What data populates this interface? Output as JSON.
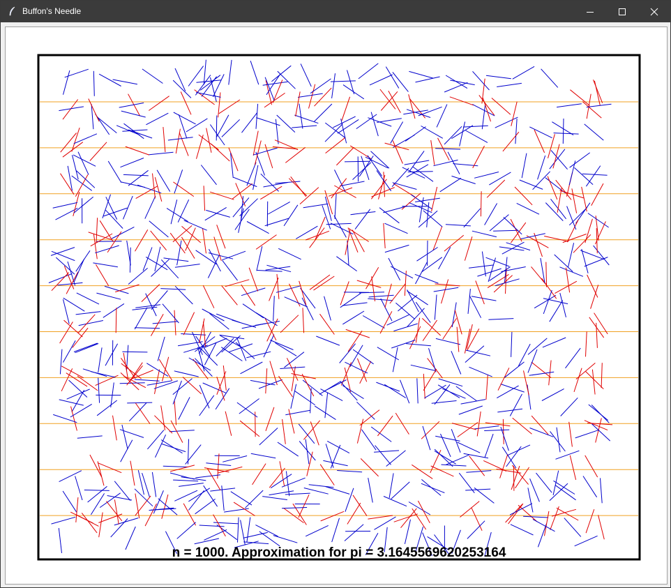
{
  "window": {
    "title": "Buffon's Needle",
    "icons": {
      "app": "feather-icon",
      "minimize": "minimize-icon",
      "maximize": "maximize-icon",
      "close": "close-icon"
    }
  },
  "simulation": {
    "needle_count": 1000,
    "status_text": "n = 1000. Approximation for pi = 3.1645569620253164",
    "pi_estimate": 3.1645569620253164,
    "parallel_lines": 10,
    "colors": {
      "crossing": "#e00000",
      "non_crossing": "#0000cc",
      "line": "#f0a020",
      "frame": "#000000"
    }
  }
}
